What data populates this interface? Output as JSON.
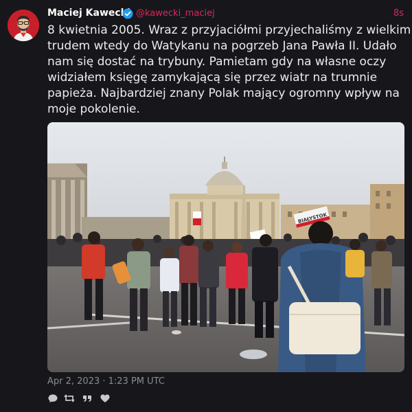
{
  "author": {
    "name": "Maciej Kawecki",
    "handle": "@kawecki_maciej",
    "verified": true,
    "avatar_color": "#c8202a"
  },
  "tweet": {
    "relative_time": "8s",
    "text_lines": [
      "8 kwietnia 2005. Wraz z przyjaciółmi przyjechaliśmy z wielkim",
      "trudem wtedy do Watykanu na pogrzeb Jana Pawła II. Udało",
      "nam się dostać na trybuny. Pamietam gdy na własne oczy",
      "widziałem księgę zamykającą się przez wiatr na trumnie",
      "papieża. Najbardziej znany Polak mający ogromny wpływ na",
      "moje pokolenie."
    ],
    "photo_sign_text": "BIAŁYSTOK",
    "timestamp": "Apr 2, 2023 · 1:23 PM UTC"
  },
  "actions": {
    "reply_icon": "reply-icon",
    "retweet_icon": "retweet-icon",
    "quote_icon": "quote-icon",
    "like_icon": "heart-icon"
  },
  "colors": {
    "background": "#17171b",
    "accent": "#e0245e",
    "verified": "#1d9bf0",
    "muted": "#8a8a93"
  }
}
